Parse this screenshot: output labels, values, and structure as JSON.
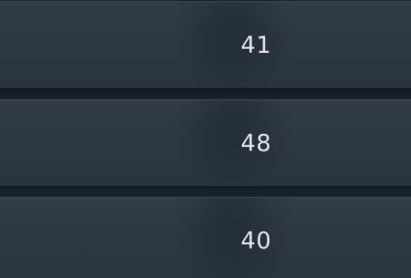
{
  "rows": [
    {
      "value": "41"
    },
    {
      "value": "48"
    },
    {
      "value": "40"
    }
  ]
}
